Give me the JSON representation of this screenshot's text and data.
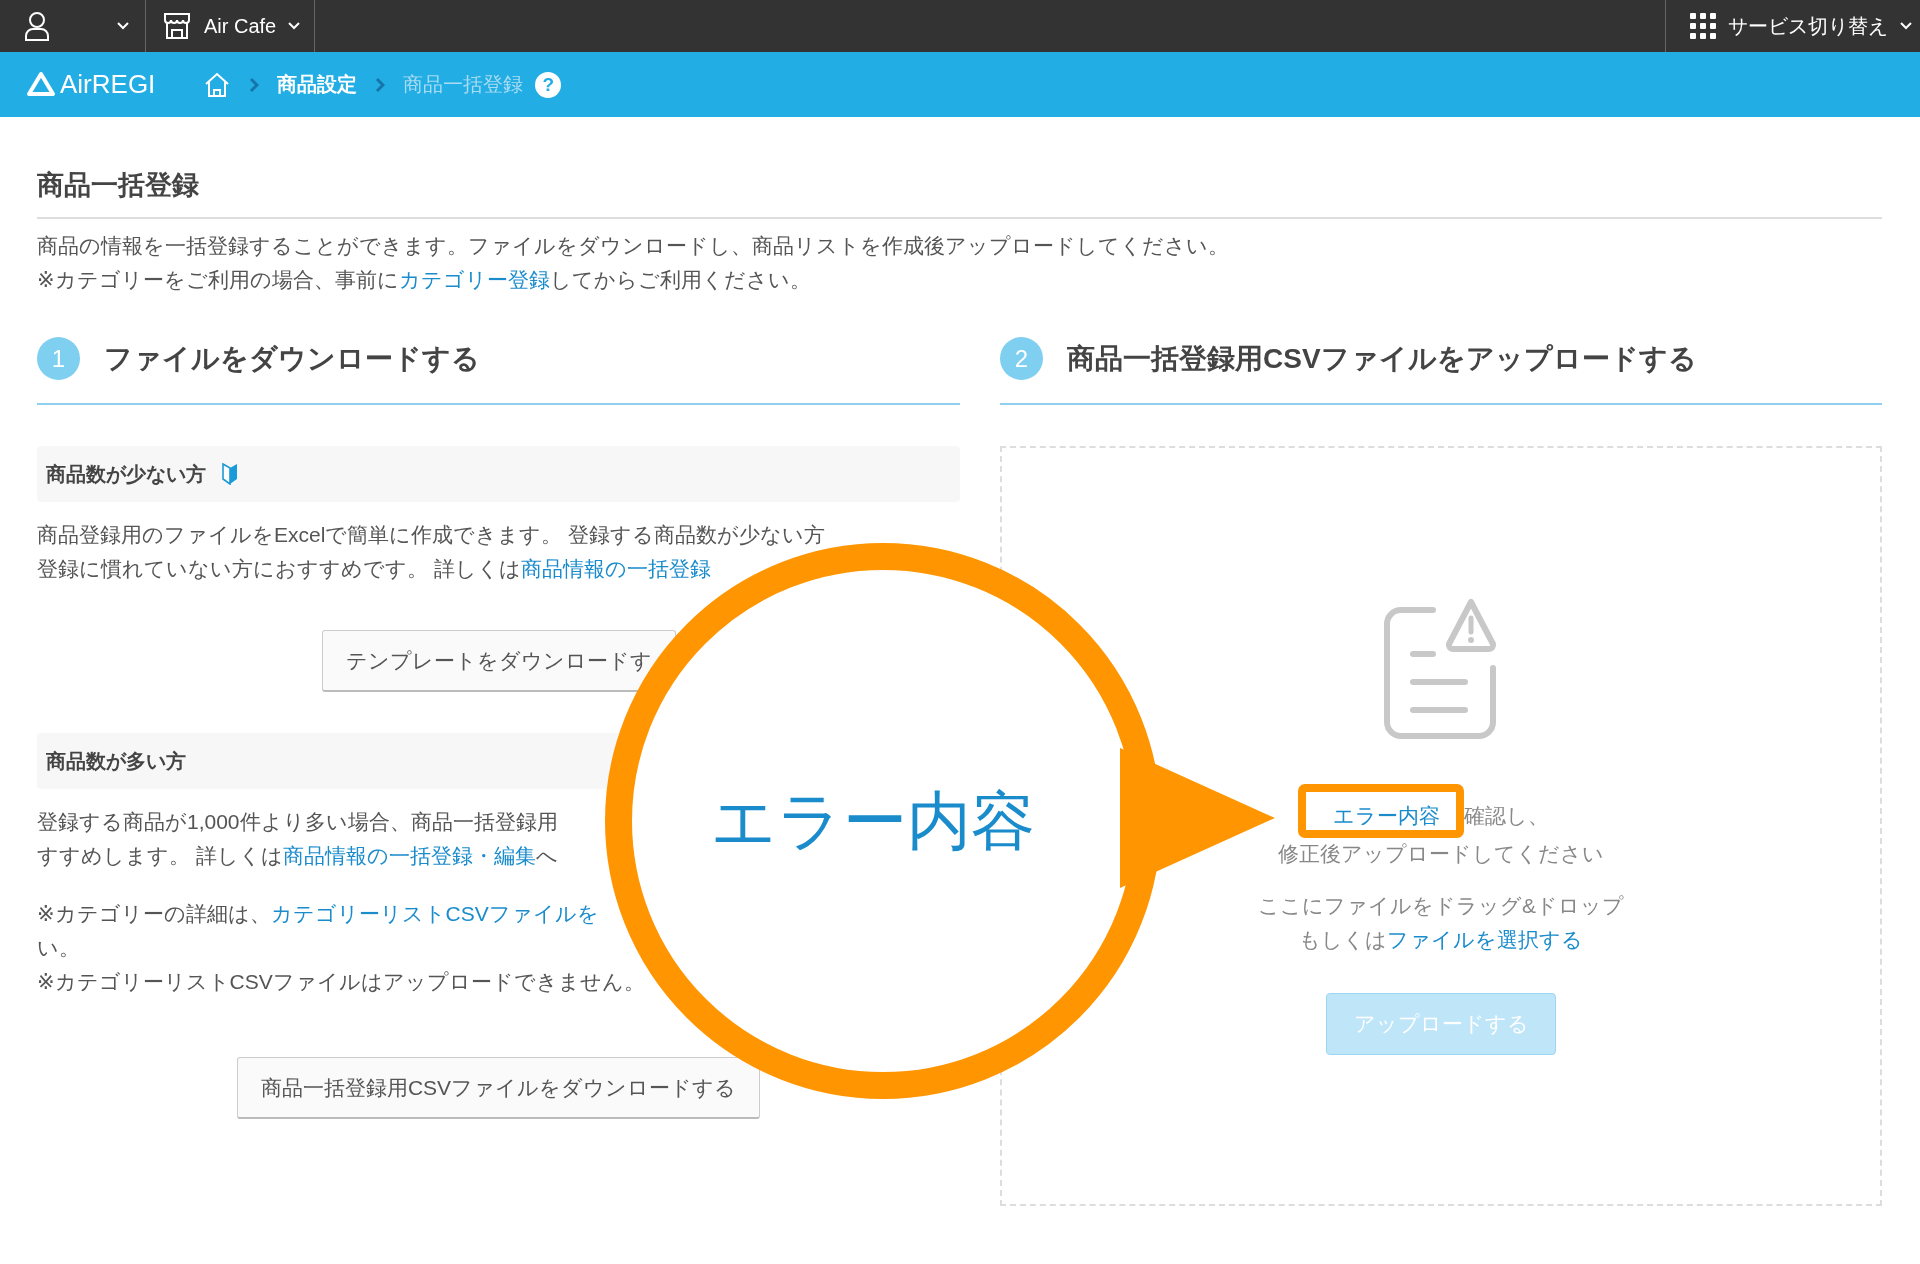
{
  "top_bar": {
    "store": {
      "label": "Air Cafe"
    },
    "service_switch": {
      "label": "サービス切り替え"
    }
  },
  "nav_bar": {
    "logo": "AirREGI",
    "breadcrumbs": [
      {
        "label": "商品設定",
        "current": false
      },
      {
        "label": "商品一括登録",
        "current": true
      }
    ],
    "help": "?"
  },
  "page": {
    "title": "商品一括登録",
    "intro": [
      [
        {
          "text": "商品の情報を一括登録することができます。ファイルをダウンロードし、商品リストを作成後アップロードしてください。",
          "link": false
        }
      ],
      [
        {
          "text": "※カテゴリーをご利用の場合、事前に",
          "link": false
        },
        {
          "text": "カテゴリー登録",
          "link": true
        },
        {
          "text": "してからご利用ください。",
          "link": false
        }
      ]
    ]
  },
  "steps": [
    {
      "number": "1",
      "title": "ファイルをダウンロードする"
    },
    {
      "number": "2",
      "title": "商品一括登録用CSVファイルをアップロードする"
    }
  ],
  "download": {
    "sections": [
      {
        "title": "商品数が少ない方",
        "beginner_mark": true,
        "paragraphs": [
          [
            [
              {
                "text": "商品登録用のファイルをExcelで簡単に作成できます。 登録する商品数が少ない方",
                "link": false
              }
            ],
            [
              {
                "text": "登録に慣れていない方におすすめです。 詳しくは",
                "link": false
              },
              {
                "text": "商品情報の一括登録",
                "link": true
              }
            ]
          ]
        ],
        "button": "テンプレートをダウンロードす"
      },
      {
        "title": "商品数が多い方",
        "beginner_mark": false,
        "paragraphs": [
          [
            [
              {
                "text": "登録する商品が1,000件より多い場合、商品一括登録用",
                "link": false
              }
            ],
            [
              {
                "text": "すすめします。 詳しくは",
                "link": false
              },
              {
                "text": "商品情報の一括登録・編集",
                "link": true
              },
              {
                "text": "へ",
                "link": false
              }
            ]
          ],
          [
            [
              {
                "text": "※カテゴリーの詳細は、",
                "link": false
              },
              {
                "text": "カテゴリーリストCSVファイルを",
                "link": true
              }
            ],
            [
              {
                "text": "い。",
                "link": false
              }
            ],
            [
              {
                "text": "※カテゴリーリストCSVファイルはアップロードできません。",
                "link": false
              }
            ]
          ]
        ],
        "button": "商品一括登録用CSVファイルをダウンロードする"
      }
    ]
  },
  "upload": {
    "error_message": [
      [
        {
          "text": "エラー内容",
          "link": true
        },
        {
          "text": "確認し、",
          "link": false
        }
      ],
      [
        {
          "text": "修正後アップロードしてください",
          "link": false
        }
      ]
    ],
    "drop_hint": [
      [
        {
          "text": "ここにファイルをドラッグ&ドロップ",
          "link": false
        }
      ],
      [
        {
          "text": "もしくは",
          "link": false
        },
        {
          "text": "ファイルを選択する",
          "link": true
        }
      ]
    ],
    "button": {
      "label": "アップロードする",
      "disabled": true
    }
  },
  "callout": {
    "text": "エラー内容"
  }
}
